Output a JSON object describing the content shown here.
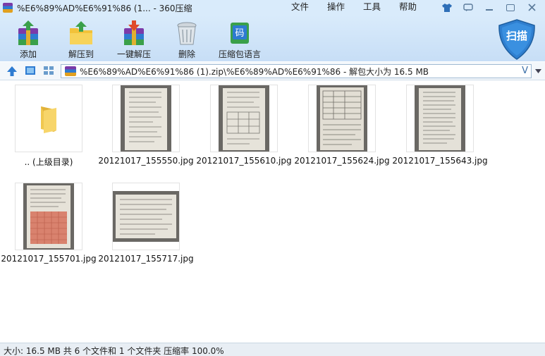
{
  "window": {
    "title": "%E6%89%AD%E6%91%86 (1... - 360压缩"
  },
  "menu": [
    "文件",
    "操作",
    "工具",
    "帮助"
  ],
  "toolbar": {
    "add": "添加",
    "extract_to": "解压到",
    "one_click_extract": "一键解压",
    "delete": "删除",
    "encoding": "压缩包语言",
    "scan": "扫描"
  },
  "address": {
    "path": "%E6%89%AD%E6%91%86 (1).zip\\%E6%89%AD%E6%91%86 - 解包大小为 16.5 MB",
    "v_label": "V"
  },
  "files": [
    {
      "name": ".. (上级目录)",
      "type": "folder"
    },
    {
      "name": "20121017_155550.jpg",
      "type": "image"
    },
    {
      "name": "20121017_155610.jpg",
      "type": "image"
    },
    {
      "name": "20121017_155624.jpg",
      "type": "image"
    },
    {
      "name": "20121017_155643.jpg",
      "type": "image"
    },
    {
      "name": "20121017_155701.jpg",
      "type": "image"
    },
    {
      "name": "20121017_155717.jpg",
      "type": "image"
    }
  ],
  "status": {
    "text": "大小: 16.5 MB 共 6 个文件和 1 个文件夹 压缩率 100.0%"
  },
  "colors": {
    "toolbar_bg": "#d9ebfb",
    "accent": "#2e7bd1",
    "scan_shield": "#2f7fd0"
  }
}
